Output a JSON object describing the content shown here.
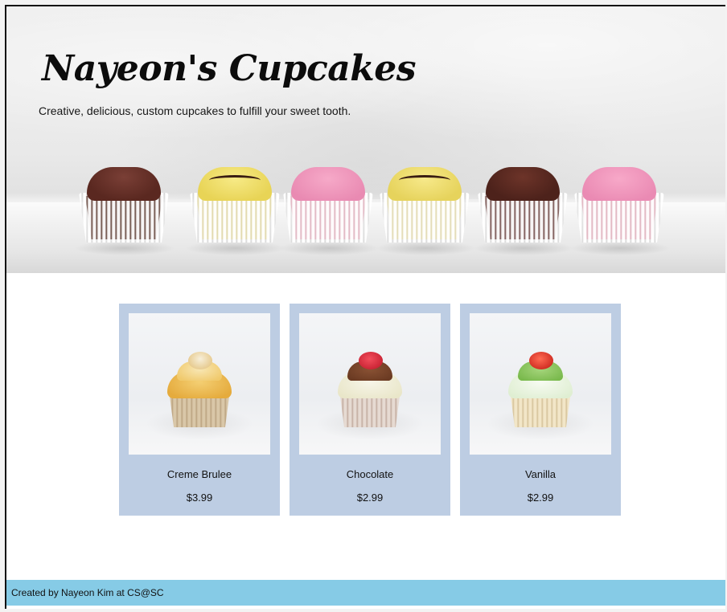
{
  "hero": {
    "title": "Nayeon's Cupcakes",
    "tagline": "Creative, delicious, custom cupcakes to fulfill your sweet tooth."
  },
  "products": [
    {
      "name": "Creme Brulee",
      "price": "$3.99"
    },
    {
      "name": "Chocolate",
      "price": "$2.99"
    },
    {
      "name": "Vanilla",
      "price": "$2.99"
    }
  ],
  "footer": {
    "text": "Created by Nayeon Kim at CS@SC"
  },
  "colors": {
    "card_background": "#bdcde3",
    "footer_background": "#86cbe6"
  }
}
